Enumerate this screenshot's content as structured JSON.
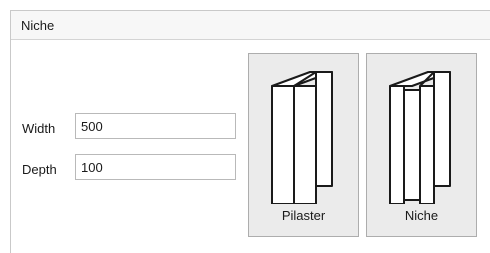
{
  "panel": {
    "title": "Niche"
  },
  "fields": {
    "width": {
      "label": "Width",
      "value": "500"
    },
    "depth": {
      "label": "Depth",
      "value": "100"
    }
  },
  "options": [
    {
      "label": "Pilaster",
      "icon": "pilaster-icon"
    },
    {
      "label": "Niche",
      "icon": "niche-icon"
    }
  ]
}
